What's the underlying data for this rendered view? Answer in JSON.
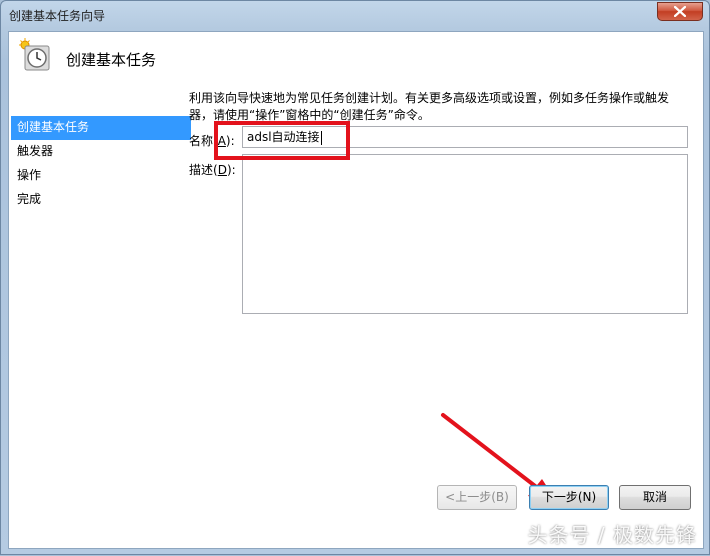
{
  "window": {
    "title": "创建基本任务向导"
  },
  "header": {
    "title": "创建基本任务",
    "icon": "task-clock-icon"
  },
  "sidebar": {
    "items": [
      {
        "label": "创建基本任务",
        "active": true
      },
      {
        "label": "触发器",
        "active": false
      },
      {
        "label": "操作",
        "active": false
      },
      {
        "label": "完成",
        "active": false
      }
    ]
  },
  "main": {
    "description": "利用该向导快速地为常见任务创建计划。有关更多高级选项或设置，例如多任务操作或触发器，请使用“操作”窗格中的“创建任务”命令。",
    "name_label": "名称(",
    "name_hotkey": "A",
    "name_label_end": "):",
    "name_value": "adsl自动连接",
    "desc_label": "描述(",
    "desc_hotkey": "D",
    "desc_label_end": "):",
    "desc_value": ""
  },
  "buttons": {
    "back": "<上一步(B)",
    "next": "下一步(N)",
    "cancel": "取消"
  },
  "watermark": "头条号 / 极数先锋",
  "colors": {
    "accent": "#3399ff",
    "annotation": "#e3121c"
  }
}
